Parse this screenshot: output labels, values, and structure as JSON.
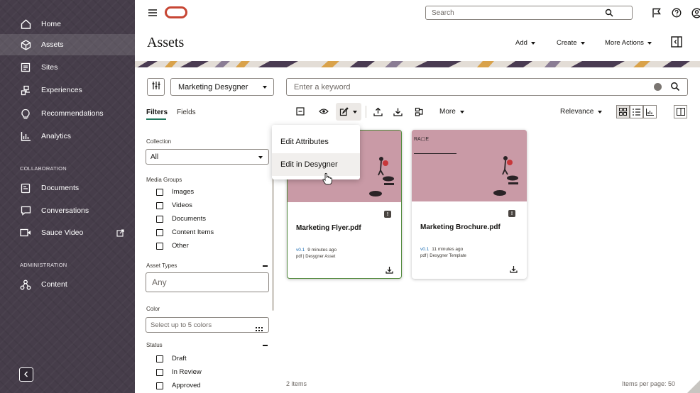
{
  "header": {
    "search_placeholder": "Search",
    "icons": [
      "menu-icon",
      "oracle-logo",
      "search-icon",
      "flag-icon",
      "help-icon",
      "user-icon"
    ]
  },
  "sidebar": {
    "items": [
      {
        "label": "Home",
        "icon": "home-icon"
      },
      {
        "label": "Assets",
        "icon": "assets-icon",
        "active": true
      },
      {
        "label": "Sites",
        "icon": "sites-icon"
      },
      {
        "label": "Experiences",
        "icon": "experiences-icon"
      },
      {
        "label": "Recommendations",
        "icon": "recommendations-icon"
      },
      {
        "label": "Analytics",
        "icon": "analytics-icon"
      }
    ],
    "collab_label": "COLLABORATION",
    "collab_items": [
      {
        "label": "Documents",
        "icon": "documents-icon"
      },
      {
        "label": "Conversations",
        "icon": "conversations-icon"
      },
      {
        "label": "Sauce Video",
        "icon": "video-icon"
      }
    ],
    "admin_label": "ADMINISTRATION",
    "admin_items": [
      {
        "label": "Content",
        "icon": "content-icon"
      }
    ]
  },
  "page": {
    "title": "Assets",
    "actions": {
      "add": "Add",
      "create": "Create",
      "more_actions": "More Actions"
    }
  },
  "filters": {
    "collection_select": "Marketing Desygner",
    "tabs": {
      "filters": "Filters",
      "fields": "Fields"
    },
    "collection_label": "Collection",
    "collection_value": "All",
    "media_groups_label": "Media Groups",
    "media_groups": [
      "Images",
      "Videos",
      "Documents",
      "Content Items",
      "Other"
    ],
    "asset_types_label": "Asset Types",
    "asset_types_value": "Any",
    "color_label": "Color",
    "color_placeholder": "Select up to 5 colors",
    "status_label": "Status",
    "statuses": [
      "Draft",
      "In Review",
      "Approved"
    ]
  },
  "main": {
    "keyword_placeholder": "Enter a keyword",
    "more_label": "More",
    "sort_label": "Relevance",
    "menu": {
      "edit_attributes": "Edit Attributes",
      "edit_in_desygner": "Edit in Desygner"
    },
    "cards": [
      {
        "title": "Marketing Flyer.pdf",
        "version": "v0.1",
        "time": "9 minutes ago",
        "type": "pdf | Desygner Asset"
      },
      {
        "title": "Marketing Brochure.pdf",
        "version": "v0.1",
        "time": "11 minutes ago",
        "type": "pdf | Desygner Template"
      }
    ],
    "item_count": "2 items",
    "items_per_page": "Items per page: 50"
  },
  "colors": {
    "sidebar": "#463d4a",
    "oracle_red": "#c74634",
    "selected_border": "#528a3c",
    "thumb": "#c99aa6"
  }
}
